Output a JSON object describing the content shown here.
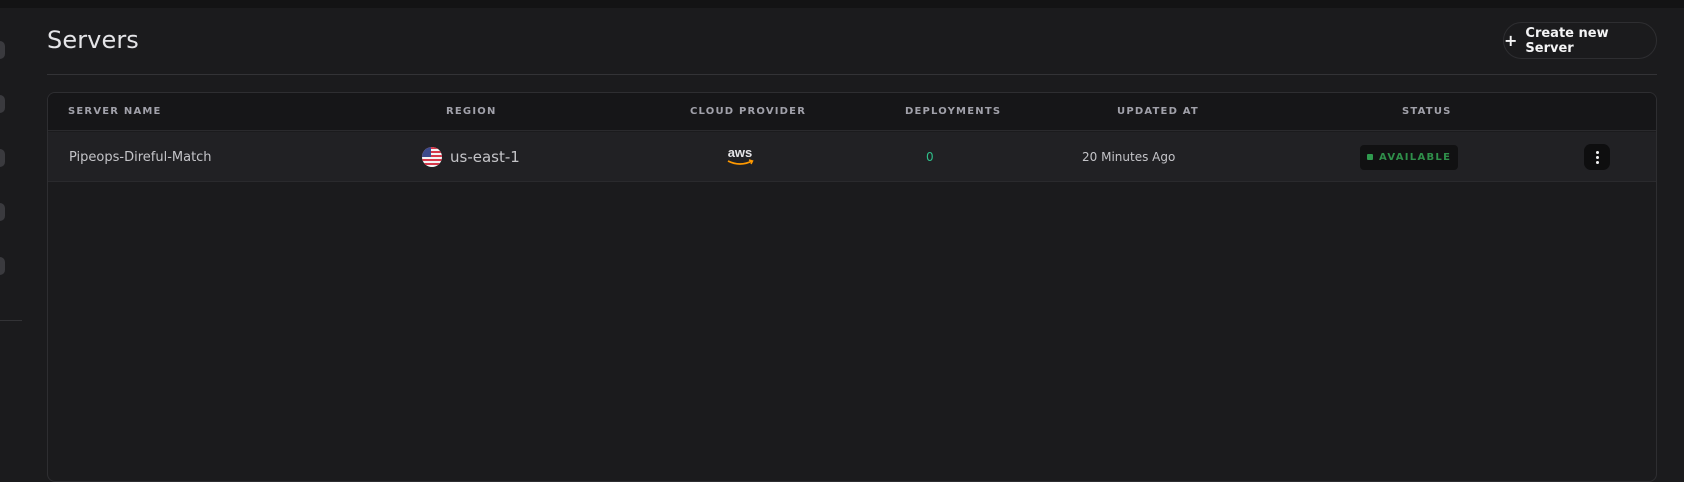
{
  "page": {
    "title": "Servers",
    "create_button_label": "Create new Server",
    "create_button_icon": "plus-icon"
  },
  "sidebar": {
    "items": [
      {
        "icon": "nav-item-icon"
      },
      {
        "icon": "nav-item-icon"
      },
      {
        "icon": "nav-item-icon"
      },
      {
        "icon": "nav-item-icon"
      },
      {
        "icon": "nav-item-icon"
      }
    ]
  },
  "table": {
    "columns": [
      "Server Name",
      "Region",
      "Cloud Provider",
      "Deployments",
      "Updated At",
      "Status"
    ],
    "rows": [
      {
        "server_name": "Pipeops-Direful-Match",
        "region": "us-east-1",
        "region_flag_icon": "us-flag-icon",
        "cloud_provider_icon": "aws-logo-icon",
        "cloud_provider_logo_text": "aws",
        "deployments": "0",
        "updated_at": "20 Minutes Ago",
        "status": "AVAILABLE",
        "actions_icon": "more-vertical-icon"
      }
    ]
  },
  "colors": {
    "background": "#1b1b1d",
    "status_available": "#2f9a4e",
    "deployments_accent": "#2fbf8a",
    "aws_orange": "#ff9900"
  }
}
